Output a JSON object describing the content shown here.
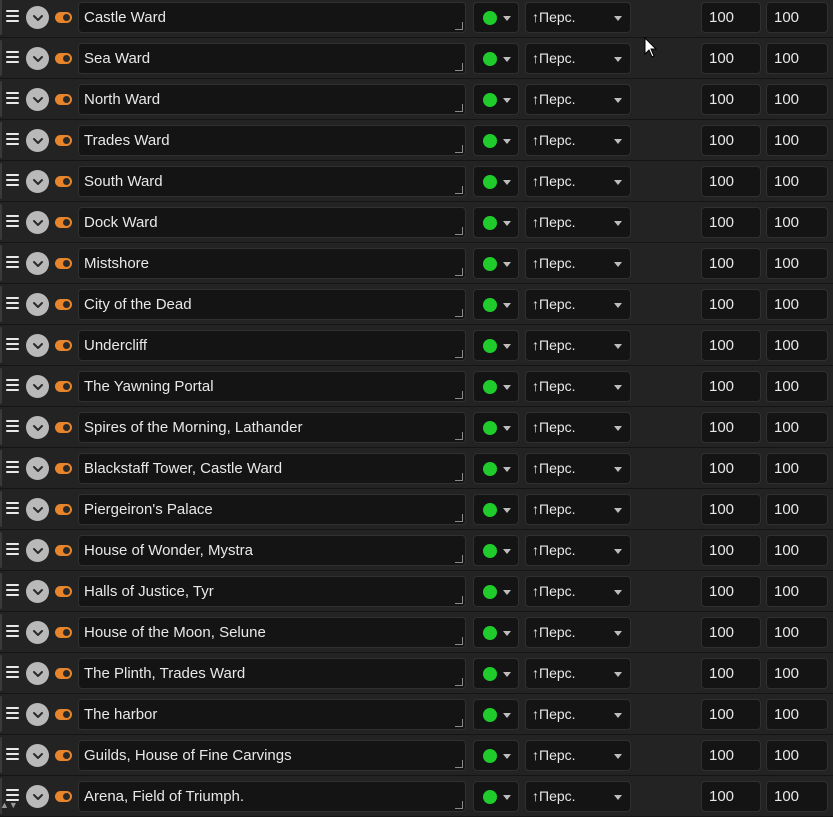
{
  "rows": [
    {
      "name": "Castle Ward",
      "sort": "↑Перс.",
      "v1": "100",
      "v2": "100"
    },
    {
      "name": "Sea Ward",
      "sort": "↑Перс.",
      "v1": "100",
      "v2": "100"
    },
    {
      "name": "North Ward",
      "sort": "↑Перс.",
      "v1": "100",
      "v2": "100"
    },
    {
      "name": "Trades Ward",
      "sort": "↑Перс.",
      "v1": "100",
      "v2": "100"
    },
    {
      "name": "South Ward",
      "sort": "↑Перс.",
      "v1": "100",
      "v2": "100"
    },
    {
      "name": "Dock Ward",
      "sort": "↑Перс.",
      "v1": "100",
      "v2": "100"
    },
    {
      "name": "Mistshore",
      "sort": "↑Перс.",
      "v1": "100",
      "v2": "100"
    },
    {
      "name": "City of the Dead",
      "sort": "↑Перс.",
      "v1": "100",
      "v2": "100"
    },
    {
      "name": "Undercliff",
      "sort": "↑Перс.",
      "v1": "100",
      "v2": "100"
    },
    {
      "name": "The Yawning Portal",
      "sort": "↑Перс.",
      "v1": "100",
      "v2": "100"
    },
    {
      "name": "Spires of the Morning, Lathander",
      "sort": "↑Перс.",
      "v1": "100",
      "v2": "100"
    },
    {
      "name": "Blackstaff Tower, Castle Ward",
      "sort": "↑Перс.",
      "v1": "100",
      "v2": "100"
    },
    {
      "name": "Piergeiron's Palace",
      "sort": "↑Перс.",
      "v1": "100",
      "v2": "100"
    },
    {
      "name": "House of Wonder, Mystra",
      "sort": "↑Перс.",
      "v1": "100",
      "v2": "100"
    },
    {
      "name": "Halls of Justice, Tyr",
      "sort": "↑Перс.",
      "v1": "100",
      "v2": "100"
    },
    {
      "name": "House of the Moon, Selune",
      "sort": "↑Перс.",
      "v1": "100",
      "v2": "100"
    },
    {
      "name": "The Plinth, Trades Ward",
      "sort": "↑Перс.",
      "v1": "100",
      "v2": "100"
    },
    {
      "name": "The harbor",
      "sort": "↑Перс.",
      "v1": "100",
      "v2": "100"
    },
    {
      "name": "Guilds, House of Fine Carvings",
      "sort": "↑Перс.",
      "v1": "100",
      "v2": "100"
    },
    {
      "name": "Arena, Field of Triumph.",
      "sort": "↑Перс.",
      "v1": "100",
      "v2": "100"
    }
  ],
  "colors": {
    "status_dot": "#1fcc2b",
    "toggle_accent": "#e8852a",
    "background": "#232323"
  },
  "icons": {
    "handle": "drag-handle-icon",
    "expand": "chevron-down-icon",
    "toggle": "visibility-toggle-icon",
    "cursor": "mouse-pointer-icon"
  }
}
